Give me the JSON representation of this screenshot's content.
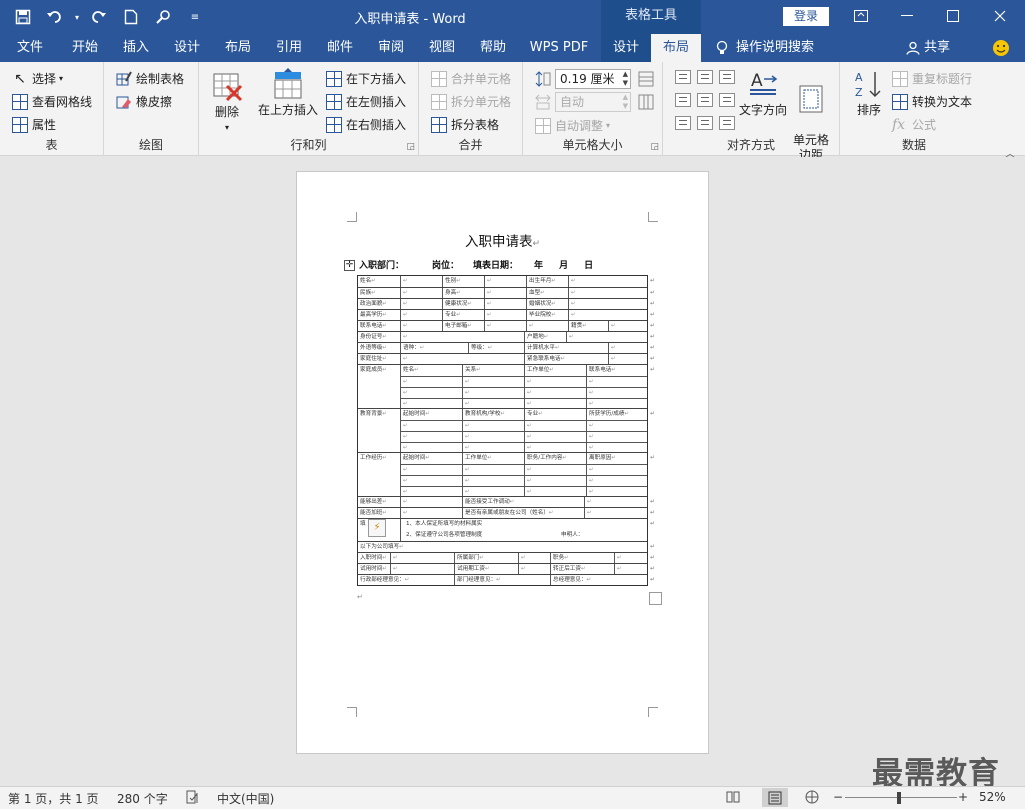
{
  "window": {
    "title": "入职申请表 - Word",
    "context_tab_group": "表格工具",
    "login_label": "登录"
  },
  "tabs": [
    "文件",
    "开始",
    "插入",
    "设计",
    "布局",
    "引用",
    "邮件",
    "审阅",
    "视图",
    "帮助",
    "WPS PDF",
    "设计",
    "布局"
  ],
  "tell_me": "操作说明搜索",
  "share_label": "共享",
  "ribbon": {
    "table_group": {
      "title": "表",
      "select": "选择",
      "view_gridlines": "查看网格线",
      "properties": "属性"
    },
    "draw_group": {
      "title": "绘图",
      "draw_table": "绘制表格",
      "eraser": "橡皮擦"
    },
    "rows_cols_group": {
      "title": "行和列",
      "delete": "删除",
      "insert_above": "在上方插入",
      "insert_below": "在下方插入",
      "insert_left": "在左侧插入",
      "insert_right": "在右侧插入"
    },
    "merge_group": {
      "title": "合并",
      "merge_cells": "合并单元格",
      "split_cells": "拆分单元格",
      "split_table": "拆分表格"
    },
    "cell_size_group": {
      "title": "单元格大小",
      "height_value": "0.19 厘米",
      "width_value": "自动",
      "autofit": "自动调整"
    },
    "align_group": {
      "title": "对齐方式",
      "text_direction": "文字方向",
      "cell_margins": "单元格\n边距"
    },
    "data_group": {
      "title": "数据",
      "sort": "排序",
      "repeat_header": "重复标题行",
      "convert_to_text": "转换为文本",
      "formula": "公式"
    }
  },
  "document": {
    "heading": "入职申请表",
    "info_line": {
      "dept": "入职部门：",
      "position": "岗位：",
      "date_label": "填表日期：",
      "year": "年",
      "month": "月",
      "day": "日"
    },
    "rows": [
      [
        "姓名",
        "",
        "性别",
        "",
        "出生年月",
        ""
      ],
      [
        "民族",
        "",
        "身高",
        "",
        "血型",
        ""
      ],
      [
        "政治面貌",
        "",
        "健康状况",
        "",
        "婚姻状况",
        ""
      ],
      [
        "最高学历",
        "",
        "专业",
        "",
        "毕业院校",
        ""
      ],
      [
        "联系电话",
        "",
        "电子邮箱",
        "",
        "",
        "籍贯",
        ""
      ],
      [
        "身份证号",
        "",
        "户籍地",
        ""
      ],
      [
        "外语等级",
        "语种：",
        "等级：",
        "计算机水平",
        ""
      ],
      [
        "家庭住址",
        "",
        "紧急联系电话",
        ""
      ],
      [
        "家庭成员",
        "姓名",
        "关系",
        "工作单位",
        "联系电话"
      ],
      [
        "教育背景",
        "起始时间",
        "教育机构/学校",
        "专业",
        "所获学历/成绩"
      ],
      [
        "工作经历",
        "起始时间",
        "工作单位",
        "职务/工作内容",
        "离职原因"
      ],
      [
        "能够出差",
        "",
        "能否接受工作调动",
        ""
      ],
      [
        "能否加班",
        "",
        "是否有亲属或朋友在公司（姓名）",
        ""
      ],
      [
        "填",
        "1、本人保证所填写的材料属实",
        "2、保证遵守公司各项管理制度",
        "申明人："
      ],
      [
        "以下为公司填写"
      ],
      [
        "入职时间",
        "",
        "所属部门",
        "",
        "职务",
        ""
      ],
      [
        "试用时间",
        "",
        "试用期工资",
        "",
        "转正后工资",
        ""
      ],
      [
        "行政部经理意见：",
        "部门经理意见：",
        "总经理意见："
      ]
    ]
  },
  "status": {
    "page": "第 1 页，共 1 页",
    "words": "280 个字",
    "language": "中文(中国)",
    "zoom": "52%"
  },
  "watermark": "最需教育"
}
